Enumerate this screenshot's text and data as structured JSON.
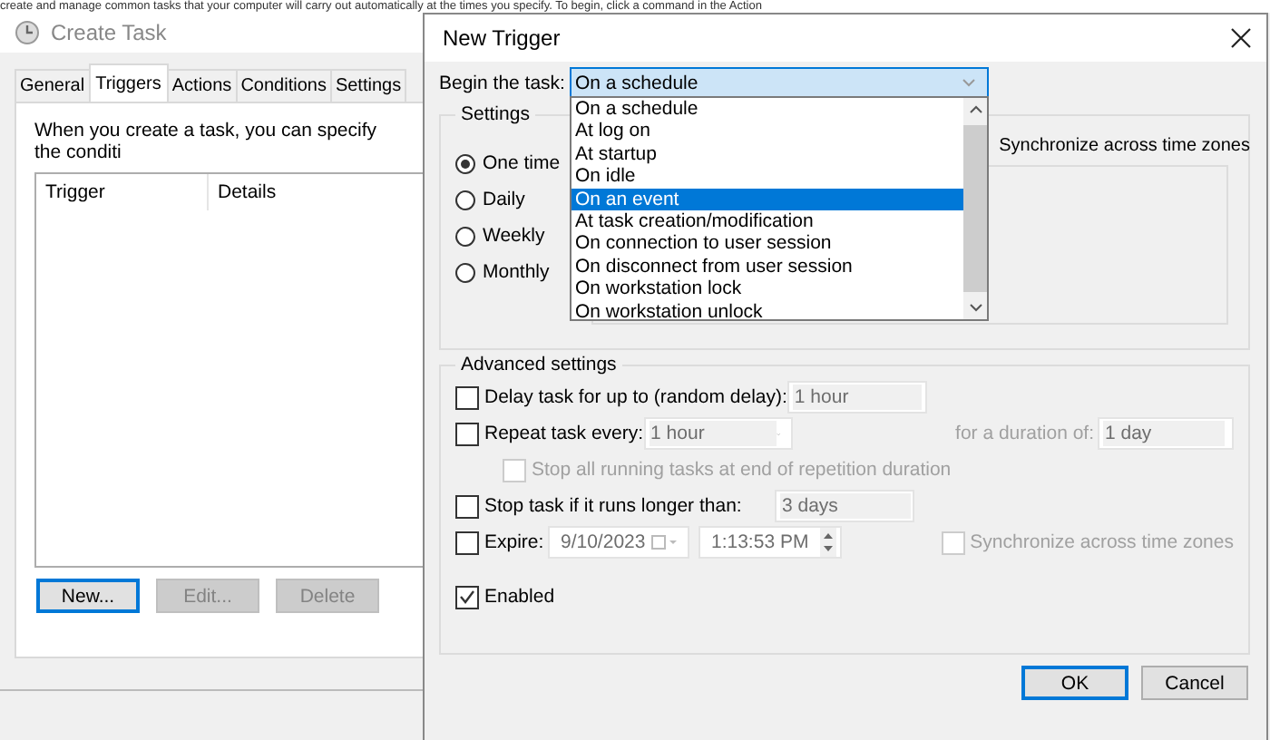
{
  "header_text": "create and manage common tasks that your computer will carry out automatically at the times you specify. To begin, click a command in the Action",
  "create_task": {
    "title": "Create Task",
    "tabs": [
      {
        "label": "General",
        "selected": false
      },
      {
        "label": "Triggers",
        "selected": true
      },
      {
        "label": "Actions",
        "selected": false
      },
      {
        "label": "Conditions",
        "selected": false
      },
      {
        "label": "Settings",
        "selected": false
      }
    ],
    "description": "When you create a task, you can specify the conditi",
    "table": {
      "columns": [
        "Trigger",
        "Details"
      ]
    },
    "buttons": [
      {
        "label": "New...",
        "disabled": false
      },
      {
        "label": "Edit...",
        "disabled": true
      },
      {
        "label": "Delete",
        "disabled": true
      }
    ]
  },
  "new_trigger": {
    "title": "New Trigger",
    "begin_label": "Begin the task:",
    "begin_value": "On a schedule",
    "dropdown": [
      {
        "label": "On a schedule",
        "selected": false
      },
      {
        "label": "At log on",
        "selected": false
      },
      {
        "label": "At startup",
        "selected": false
      },
      {
        "label": "On idle",
        "selected": false
      },
      {
        "label": "On an event",
        "selected": true
      },
      {
        "label": "At task creation/modification",
        "selected": false
      },
      {
        "label": "On connection to user session",
        "selected": false
      },
      {
        "label": "On disconnect from user session",
        "selected": false
      },
      {
        "label": "On workstation lock",
        "selected": false
      },
      {
        "label": "On workstation unlock",
        "selected": false
      }
    ],
    "settings": {
      "title": "Settings",
      "schedule": [
        {
          "label": "One time",
          "selected": true
        },
        {
          "label": "Daily",
          "selected": false
        },
        {
          "label": "Weekly",
          "selected": false
        },
        {
          "label": "Monthly",
          "selected": false
        }
      ],
      "sync_label": "Synchronize across time zones"
    },
    "advanced": {
      "title": "Advanced settings",
      "delay": {
        "label": "Delay task for up to (random delay):",
        "checked": false,
        "value": {
          "text": "1 hour",
          "disabled": true
        }
      },
      "repeat": {
        "label": "Repeat task every:",
        "checked": false,
        "value": {
          "text": "1 hour",
          "disabled": true
        },
        "duration_label": "for a duration of:",
        "duration": {
          "text": "1 day",
          "disabled": true
        }
      },
      "stop_all": {
        "label": "Stop all running tasks at end of repetition duration",
        "checked": false,
        "disabled": true
      },
      "stop_longer": {
        "label": "Stop task if it runs longer than:",
        "checked": false,
        "value": {
          "text": "3 days",
          "disabled": true
        }
      },
      "expire": {
        "label": "Expire:",
        "checked": false,
        "date": "9/10/2023",
        "time": "1:13:53 PM",
        "sync": {
          "label": "Synchronize across time zones",
          "checked": false,
          "disabled": true
        }
      },
      "enabled": {
        "label": "Enabled",
        "checked": true
      }
    },
    "buttons": [
      {
        "label": "OK",
        "default": true
      },
      {
        "label": "Cancel",
        "default": false
      }
    ]
  }
}
